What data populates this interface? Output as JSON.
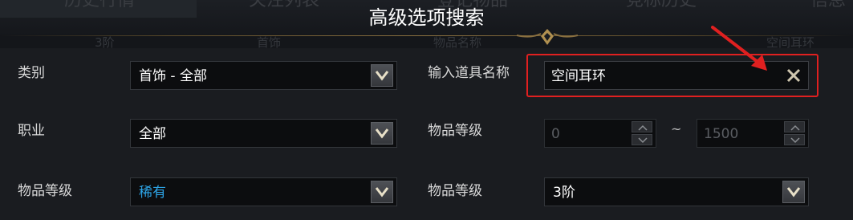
{
  "dialog": {
    "title": "高级选项搜索"
  },
  "background": {
    "tabs": [
      "历史行情",
      "关注列表",
      "登记物品",
      "竞标历史",
      "信息"
    ],
    "row_items": [
      "3阶",
      "首饰",
      "物品名称",
      "空间耳环"
    ]
  },
  "form": {
    "category": {
      "label": "类别",
      "value": "首饰 - 全部"
    },
    "job": {
      "label": "职业",
      "value": "全部"
    },
    "grade": {
      "label": "物品等级",
      "value": "稀有"
    },
    "item_name": {
      "label": "输入道具名称",
      "value": "空间耳环"
    },
    "item_level": {
      "label": "物品等级",
      "min": "0",
      "separator": "~",
      "max": "1500"
    },
    "tier": {
      "label": "物品等级",
      "value": "3阶"
    }
  },
  "colors": {
    "highlight": "#e02020",
    "grade_value": "#2da4e6",
    "accent_gold": "#8a7040"
  }
}
